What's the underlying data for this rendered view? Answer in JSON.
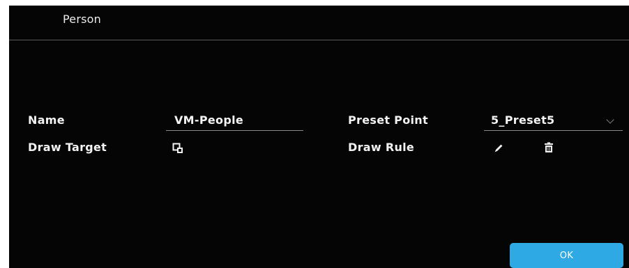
{
  "dialog": {
    "title": "Person"
  },
  "fields": {
    "name_label": "Name",
    "name_value": "VM-People",
    "preset_label": "Preset Point",
    "preset_value": "5_Preset5",
    "draw_target_label": "Draw Target",
    "draw_rule_label": "Draw Rule"
  },
  "actions": {
    "ok_label": "OK"
  },
  "colors": {
    "background": "#050505",
    "text": "#f2f2f2",
    "divider": "#5a5a5a",
    "accent": "#2fa9e3"
  },
  "icons": {
    "draw_target": "draw-target-icon",
    "draw_rule_edit": "pencil-icon",
    "draw_rule_delete": "trash-icon",
    "dropdown": "chevron-down-icon"
  }
}
